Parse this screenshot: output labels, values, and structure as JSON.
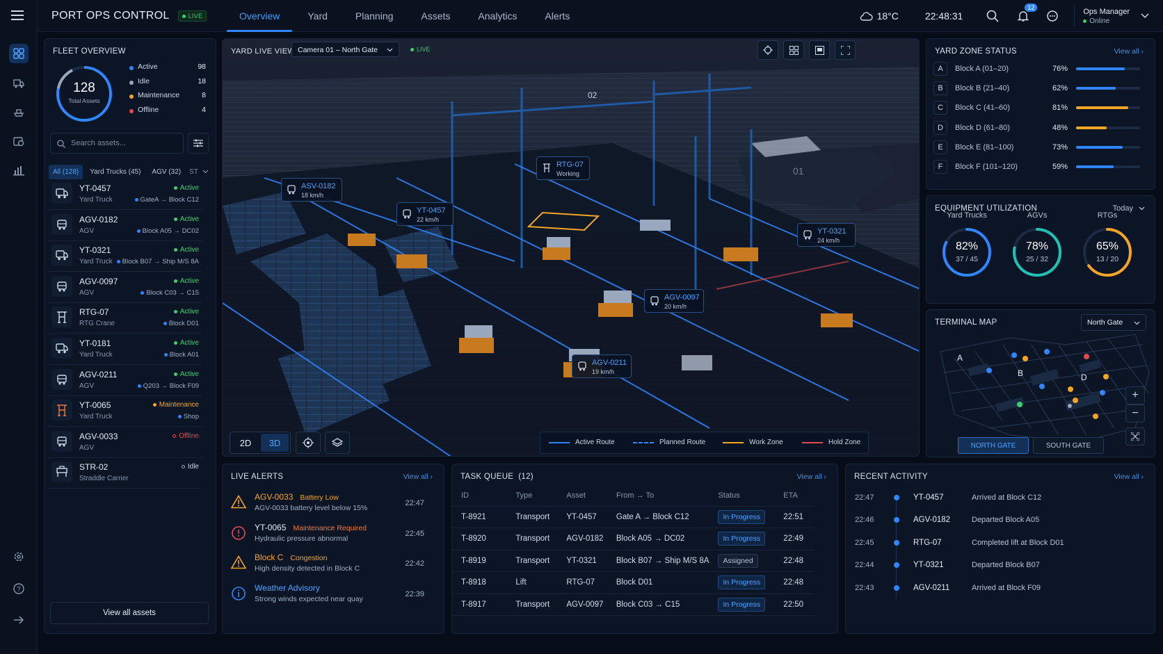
{
  "app": {
    "title": "PORT OPS CONTROL",
    "live": "LIVE"
  },
  "nav": {
    "tabs": [
      "Overview",
      "Yard",
      "Planning",
      "Assets",
      "Analytics",
      "Alerts"
    ]
  },
  "header": {
    "weather": "18°C",
    "clock": "22:48:31",
    "notifications": "12",
    "user": "Ops Manager",
    "user_status": "Online"
  },
  "fleet": {
    "title": "FLEET OVERVIEW",
    "total": "128",
    "total_label": "Total Assets",
    "legend": [
      {
        "label": "Active",
        "value": "98",
        "color": "#2f86ff"
      },
      {
        "label": "Idle",
        "value": "18",
        "color": "#9aa8bd"
      },
      {
        "label": "Maintenance",
        "value": "8",
        "color": "#f5a524"
      },
      {
        "label": "Offline",
        "value": "4",
        "color": "#e5484d"
      }
    ],
    "search_placeholder": "Search assets...",
    "filters": [
      "All (128)",
      "Yard Trucks (45)",
      "AGV (32)",
      "ST"
    ],
    "assets": [
      {
        "id": "YT-0457",
        "type": "Yard Truck",
        "status": "Active",
        "loc": "GateA → Block C12",
        "icon": "truck"
      },
      {
        "id": "AGV-0182",
        "type": "AGV",
        "status": "Active",
        "loc": "Block A05 → DC02",
        "icon": "agv"
      },
      {
        "id": "YT-0321",
        "type": "Yard Truck",
        "status": "Active",
        "loc": "Block B07 → Ship M/S 8A",
        "icon": "truck"
      },
      {
        "id": "AGV-0097",
        "type": "AGV",
        "status": "Active",
        "loc": "Block C03 → C15",
        "icon": "agv"
      },
      {
        "id": "RTG-07",
        "type": "RTG Crane",
        "status": "Active",
        "loc": "Block D01",
        "icon": "crane"
      },
      {
        "id": "YT-0181",
        "type": "Yard Truck",
        "status": "Active",
        "loc": "Block A01",
        "icon": "truck"
      },
      {
        "id": "AGV-0211",
        "type": "AGV",
        "status": "Active",
        "loc": "Q203 → Block F09",
        "icon": "agv"
      },
      {
        "id": "YT-0065",
        "type": "Yard Truck",
        "status": "Maintenance",
        "loc": "Shop",
        "icon": "crane-orange"
      },
      {
        "id": "AGV-0033",
        "type": "AGV",
        "status": "Offline",
        "loc": "",
        "icon": "agv"
      },
      {
        "id": "STR-02",
        "type": "Straddle Carrier",
        "status": "Idle",
        "loc": "",
        "icon": "straddle"
      }
    ],
    "view_all": "View all assets"
  },
  "yard": {
    "title": "YARD LIVE VIEW",
    "camera": "Camera 01 – North Gate",
    "live": "LIVE",
    "view_modes": [
      "2D",
      "3D"
    ],
    "callouts": [
      {
        "id": "ASV-0182",
        "sub": "18 km/h"
      },
      {
        "id": "RTG-07",
        "sub": "Working"
      },
      {
        "id": "YT-0457",
        "sub": "22 km/h"
      },
      {
        "id": "YT-0321",
        "sub": "24 km/h"
      },
      {
        "id": "AGV-0097",
        "sub": "20 km/h"
      },
      {
        "id": "AGV-0211",
        "sub": "19 km/h"
      }
    ],
    "legend": [
      {
        "label": "Active Route",
        "color": "#2f86ff"
      },
      {
        "label": "Planned Route",
        "color": "#2f86ff"
      },
      {
        "label": "Work Zone",
        "color": "#f5a524"
      },
      {
        "label": "Hold Zone",
        "color": "#e5484d"
      }
    ]
  },
  "zones": {
    "title": "YARD ZONE STATUS",
    "view_all": "View all",
    "items": [
      {
        "letter": "A",
        "name": "Block A (01–20)",
        "pct": "76%",
        "value": 76,
        "color": "#2f86ff"
      },
      {
        "letter": "B",
        "name": "Block B (21–40)",
        "pct": "62%",
        "value": 62,
        "color": "#2f86ff"
      },
      {
        "letter": "C",
        "name": "Block C (41–60)",
        "pct": "81%",
        "value": 81,
        "color": "#f5a524"
      },
      {
        "letter": "D",
        "name": "Block D (61–80)",
        "pct": "48%",
        "value": 48,
        "color": "#f5a524"
      },
      {
        "letter": "E",
        "name": "Block E (81–100)",
        "pct": "73%",
        "value": 73,
        "color": "#2f86ff"
      },
      {
        "letter": "F",
        "name": "Block F (101–120)",
        "pct": "59%",
        "value": 59,
        "color": "#2f86ff"
      }
    ]
  },
  "equipment": {
    "title": "EQUIPMENT UTILIZATION",
    "period": "Today",
    "gauges": [
      {
        "label": "Yard Trucks",
        "pct": "82%",
        "sub": "37 / 45",
        "value": 82,
        "color": "#2f86ff"
      },
      {
        "label": "AGVs",
        "pct": "78%",
        "sub": "25 / 32",
        "value": 78,
        "color": "#20c1b5"
      },
      {
        "label": "RTGs",
        "pct": "65%",
        "sub": "13 / 20",
        "value": 65,
        "color": "#f5a524"
      }
    ]
  },
  "terminal_map": {
    "title": "TERMINAL MAP",
    "gate_select": "North Gate",
    "labels": [
      "A",
      "B",
      "D"
    ],
    "gates": [
      "NORTH GATE",
      "SOUTH GATE"
    ]
  },
  "alerts": {
    "title": "LIVE ALERTS",
    "view_all": "View all",
    "items": [
      {
        "name": "AGV-0033",
        "tag": "Battery Low",
        "desc": "AGV-0033 battery level below 15%",
        "time": "22:47",
        "kind": "warning"
      },
      {
        "name": "YT-0065",
        "tag": "Maintenance Required",
        "desc": "Hydraulic pressure abnormal",
        "time": "22:45",
        "kind": "error"
      },
      {
        "name": "Block C",
        "tag": "Congestion",
        "desc": "High density detected in Block C",
        "time": "22:42",
        "kind": "warning"
      },
      {
        "name": "Weather Advisory",
        "tag": "",
        "desc": "Strong winds expected near quay",
        "time": "22:39",
        "kind": "info"
      }
    ]
  },
  "tasks": {
    "title": "TASK QUEUE  (12)",
    "view_all": "View all",
    "columns": [
      "ID",
      "Type",
      "Asset",
      "From → To",
      "Status",
      "ETA"
    ],
    "rows": [
      [
        "T-8921",
        "Transport",
        "YT-0457",
        "Gate A → Block C12",
        "In Progress",
        "22:51"
      ],
      [
        "T-8920",
        "Transport",
        "AGV-0182",
        "Block A05 → DC02",
        "In Progress",
        "22:49"
      ],
      [
        "T-8919",
        "Transport",
        "YT-0321",
        "Block B07 → Ship M/S 8A",
        "Assigned",
        "22:48"
      ],
      [
        "T-8918",
        "Lift",
        "RTG-07",
        "Block D01",
        "In Progress",
        "22:48"
      ],
      [
        "T-8917",
        "Transport",
        "AGV-0097",
        "Block C03 → C15",
        "In Progress",
        "22:50"
      ]
    ]
  },
  "activity": {
    "title": "RECENT ACTIVITY",
    "view_all": "View all",
    "items": [
      {
        "time": "22:47",
        "id": "YT-0457",
        "text": "Arrived at Block C12"
      },
      {
        "time": "22:46",
        "id": "AGV-0182",
        "text": "Departed Block A05"
      },
      {
        "time": "22:45",
        "id": "RTG-07",
        "text": "Completed lift at Block D01"
      },
      {
        "time": "22:44",
        "id": "YT-0321",
        "text": "Departed Block B07"
      },
      {
        "time": "22:43",
        "id": "AGV-0211",
        "text": "Arrived at Block F09"
      }
    ]
  }
}
